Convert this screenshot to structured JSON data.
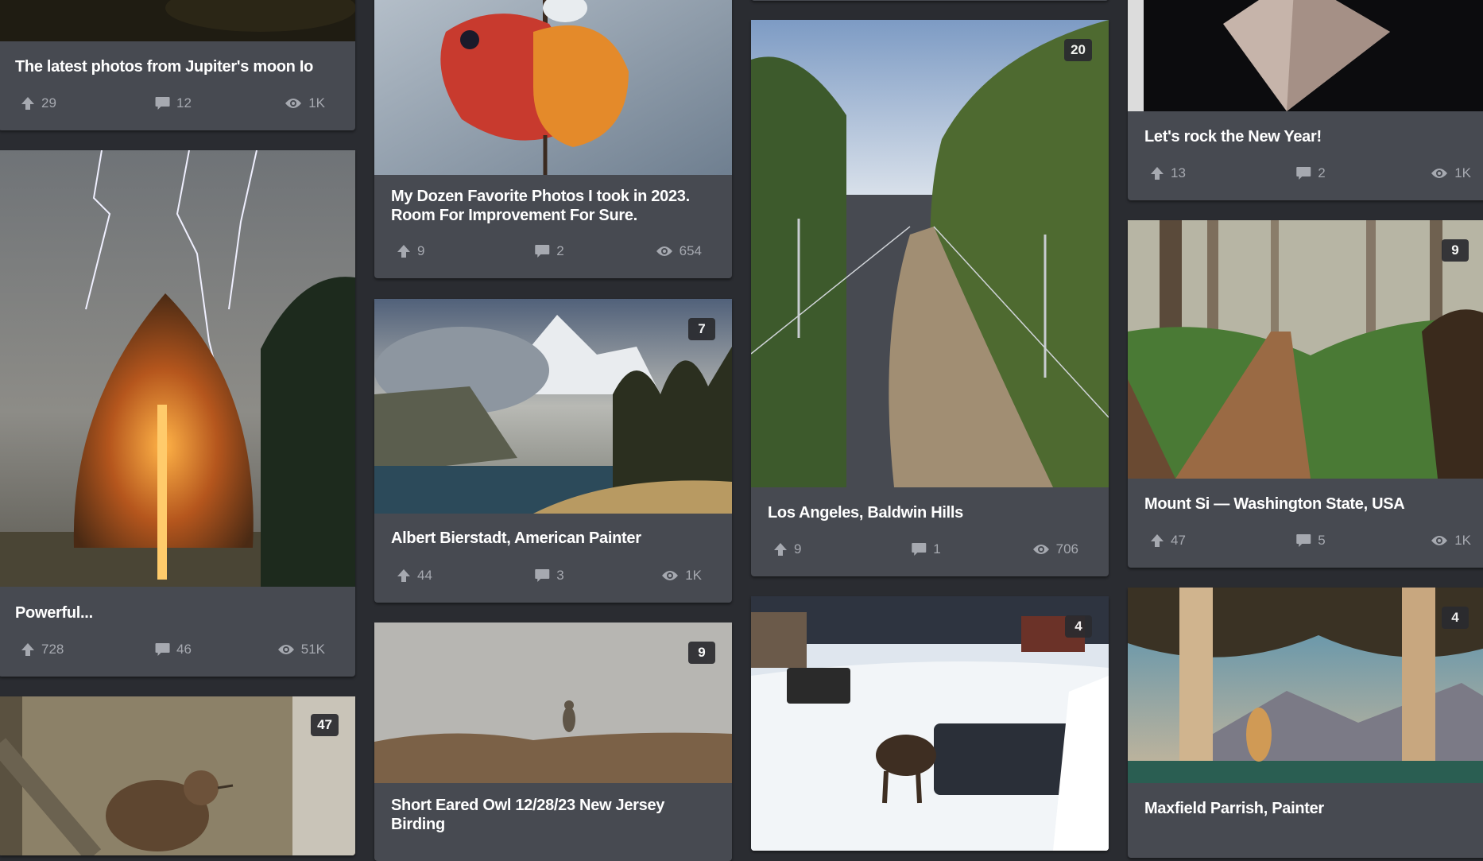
{
  "cards": [
    {
      "id": "io",
      "title": "The latest photos from Jupiter's moon Io",
      "upvotes": "29",
      "comments": "12",
      "views": "1K",
      "image_count": null
    },
    {
      "id": "powerful",
      "title": "Powerful...",
      "upvotes": "728",
      "comments": "46",
      "views": "51K",
      "image_count": null
    },
    {
      "id": "wren",
      "title": "",
      "upvotes": "",
      "comments": "",
      "views": "",
      "image_count": "47"
    },
    {
      "id": "dozen",
      "title": "My Dozen Favorite Photos I took in 2023. Room For Improvement For Sure.",
      "upvotes": "9",
      "comments": "2",
      "views": "654",
      "image_count": null
    },
    {
      "id": "bierstadt",
      "title": "Albert Bierstadt, American Painter",
      "upvotes": "44",
      "comments": "3",
      "views": "1K",
      "image_count": "7"
    },
    {
      "id": "owl",
      "title": "Short Eared Owl 12/28/23 New Jersey Birding",
      "upvotes": "",
      "comments": "",
      "views": "",
      "image_count": "9"
    },
    {
      "id": "la",
      "title": "Los Angeles, Baldwin Hills",
      "upvotes": "9",
      "comments": "1",
      "views": "706",
      "image_count": "20"
    },
    {
      "id": "moose",
      "title": "",
      "upvotes": "",
      "comments": "",
      "views": "",
      "image_count": "4"
    },
    {
      "id": "rock",
      "title": "Let's rock the New Year!",
      "upvotes": "13",
      "comments": "2",
      "views": "1K",
      "image_count": null
    },
    {
      "id": "mountsi",
      "title": "Mount Si — Washington State, USA",
      "upvotes": "47",
      "comments": "5",
      "views": "1K",
      "image_count": "9"
    },
    {
      "id": "parrish",
      "title": "Maxfield Parrish, Painter",
      "upvotes": "",
      "comments": "",
      "views": "",
      "image_count": "4"
    }
  ],
  "icons": {
    "upvote": "up-arrow-icon",
    "comment": "speech-bubble-icon",
    "view": "eye-icon"
  },
  "colors": {
    "page_bg": "#2a2c31",
    "card_bg": "#474a51",
    "meta_text": "#a6a9b0",
    "title_text": "#ffffff"
  }
}
